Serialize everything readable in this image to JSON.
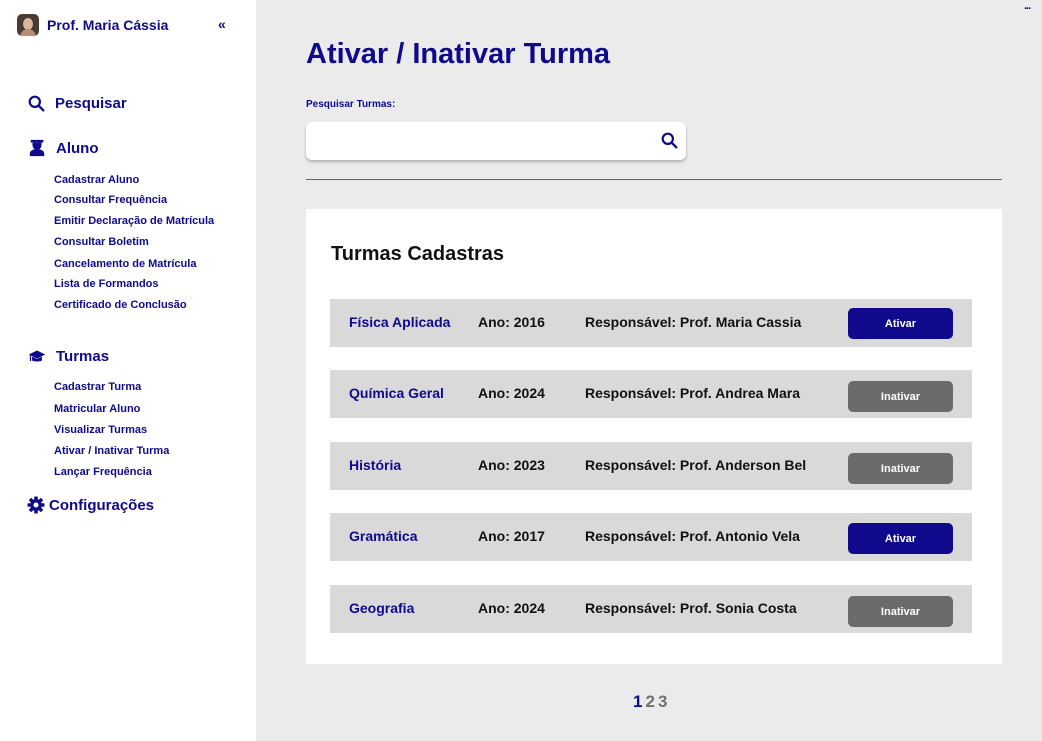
{
  "sidebar": {
    "profile_name": "Prof. Maria Cássia",
    "collapse_label": "«",
    "search_label": "Pesquisar",
    "aluno": {
      "label": "Aluno",
      "items": [
        "Cadastrar Aluno",
        "Consultar Frequência",
        "Emitir Declaração de Matrícula",
        "Consultar Boletim",
        "Cancelamento de Matrícula",
        "Lista de Formandos",
        "Certificado de Conclusão"
      ]
    },
    "turmas": {
      "label": "Turmas",
      "items": [
        "Cadastrar Turma",
        "Matricular Aluno",
        "Visualizar Turmas",
        "Ativar / Inativar Turma",
        "Lançar Frequência"
      ]
    },
    "config_label": "Configurações"
  },
  "main": {
    "title": "Ativar / Inativar Turma",
    "search_label": "Pesquisar Turmas:",
    "search_value": "",
    "panel_title": "Turmas Cadastras",
    "rows": [
      {
        "name": "Física Aplicada",
        "year": "Ano: 2016",
        "resp": "Responsável: Prof. Maria Cassia",
        "action": "Ativar"
      },
      {
        "name": "Química Geral",
        "year": "Ano: 2024",
        "resp": "Responsável: Prof. Andrea Mara",
        "action": "Inativar"
      },
      {
        "name": "História",
        "year": "Ano: 2023",
        "resp": "Responsável: Prof. Anderson Bel",
        "action": "Inativar"
      },
      {
        "name": "Gramática",
        "year": "Ano: 2017",
        "resp": "Responsável: Prof. Antonio Vela",
        "action": "Ativar"
      },
      {
        "name": "Geografia",
        "year": "Ano: 2024",
        "resp": "Responsável: Prof. Sonia Costa",
        "action": "Inativar"
      }
    ],
    "pages": [
      "1",
      "2",
      "3"
    ],
    "current_page": "1"
  },
  "more_label": "...",
  "colors": {
    "primary": "#0f0a8c",
    "inactive_button": "#6b6b6b",
    "row_bg": "#d9d9d9",
    "page_bg": "#ebebeb"
  },
  "icons": {
    "search": "search-icon",
    "aluno": "student-icon",
    "turmas": "graduation-cap-icon",
    "config": "gear-icon"
  }
}
